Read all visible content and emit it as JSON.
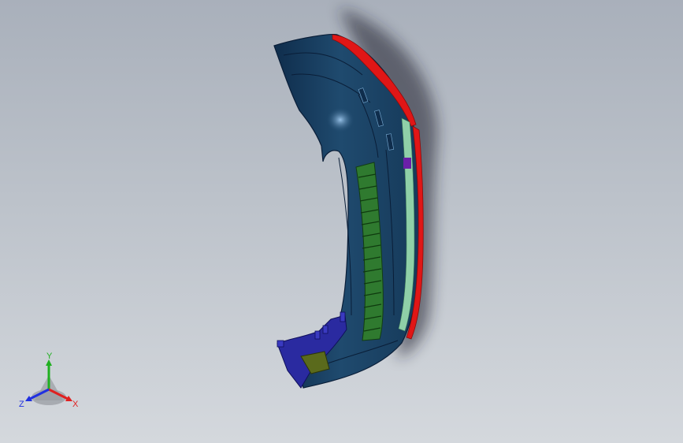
{
  "viewport": {
    "background_top": "#a9b0bb",
    "background_bottom": "#d4d8dd"
  },
  "model": {
    "name": "bumper-part",
    "colors": {
      "body": "#1f4a6e",
      "body_dark": "#0f2d4c",
      "edge_red": "#e01616",
      "grille_green": "#2f7a2f",
      "strip_mint": "#8fd0a8",
      "bracket_olive": "#5a6a1c",
      "bracket_blue": "#2a2aa0"
    }
  },
  "triad": {
    "x_label": "X",
    "y_label": "Y",
    "z_label": "Z",
    "x_color": "#e02020",
    "y_color": "#20b020",
    "z_color": "#2030e0"
  }
}
